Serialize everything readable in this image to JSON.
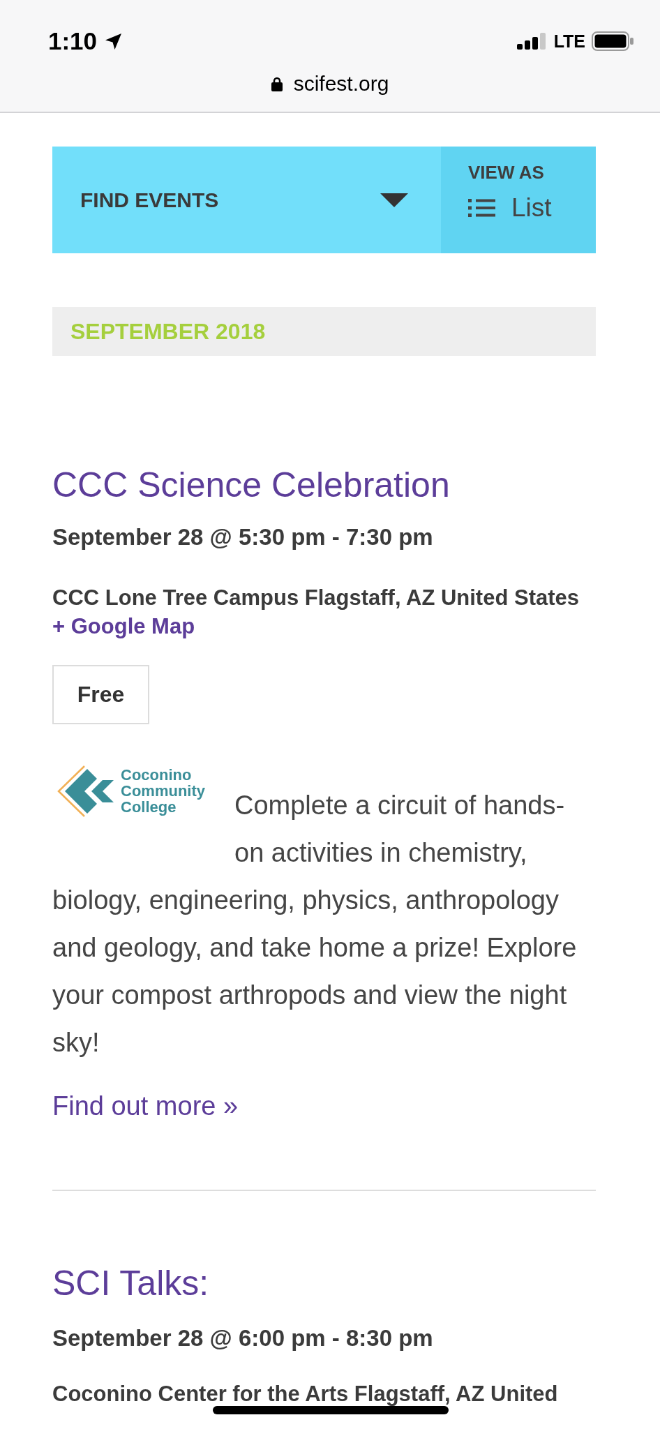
{
  "status_bar": {
    "time": "1:10",
    "network": "LTE"
  },
  "address_bar": {
    "url": "scifest.org"
  },
  "event_bar": {
    "find_label": "FIND EVENTS",
    "view_as_label": "VIEW AS",
    "view_mode": "List"
  },
  "month_header": "SEPTEMBER 2018",
  "events": [
    {
      "title": "CCC Science Celebration",
      "datetime": "September 28 @ 5:30 pm - 7:30 pm",
      "venue": "CCC Lone Tree Campus Flagstaff, AZ United States",
      "map_link": "+ Google Map",
      "cost": "Free",
      "logo_text": [
        "Coconino",
        "Community",
        "College"
      ],
      "description": [
        "Complete a circuit of hands-on activities in chemistry,",
        "biology, engineering, physics, anthropology and geology, and take home a prize! Explore your compost arthropods and view the night sky!"
      ],
      "more_link": "Find out more »"
    },
    {
      "title": "SCI Talks:",
      "datetime": "September 28 @ 6:00 pm - 8:30 pm",
      "venue": "Coconino Center for the Arts Flagstaff, AZ United"
    }
  ]
}
